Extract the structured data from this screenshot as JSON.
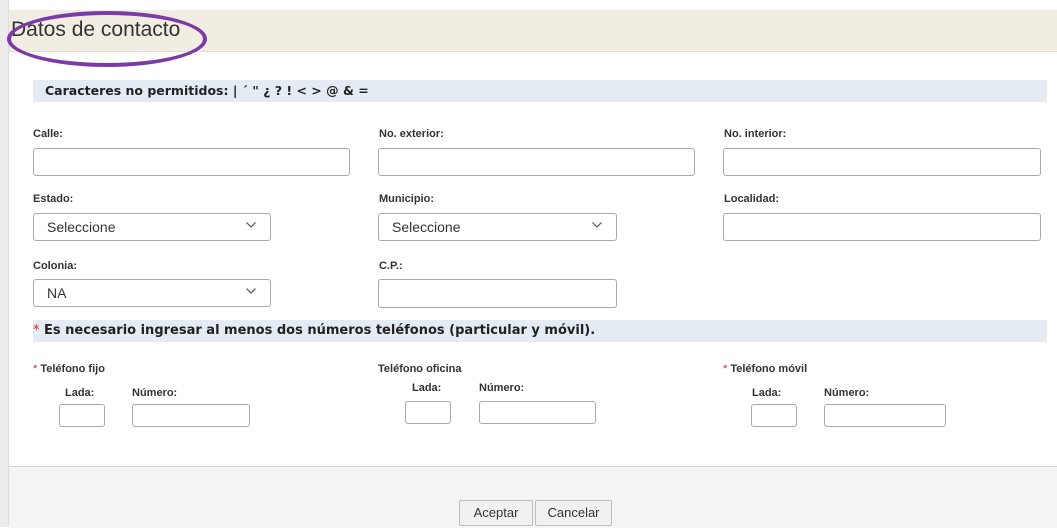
{
  "title": "Datos de contacto",
  "notice": "Caracteres no permitidos: | ´ \" ¿ ? ! < > @ & =",
  "address": {
    "calle_label": "Calle:",
    "no_exterior_label": "No. exterior:",
    "no_interior_label": "No. interior:",
    "estado_label": "Estado:",
    "estado_value": "Seleccione",
    "municipio_label": "Municipio:",
    "municipio_value": "Seleccione",
    "localidad_label": "Localidad:",
    "colonia_label": "Colonia:",
    "colonia_value": "NA",
    "cp_label": "C.P.:"
  },
  "phones": {
    "required_marker": "*",
    "note": "Es necesario ingresar al menos dos números teléfonos (particular y móvil).",
    "fijo_label": "Teléfono fijo",
    "oficina_label": "Teléfono oficina",
    "movil_label": "Teléfono móvil",
    "lada_label": "Lada:",
    "numero_label": "Número:"
  },
  "buttons": {
    "accept": "Aceptar",
    "cancel": "Cancelar"
  }
}
